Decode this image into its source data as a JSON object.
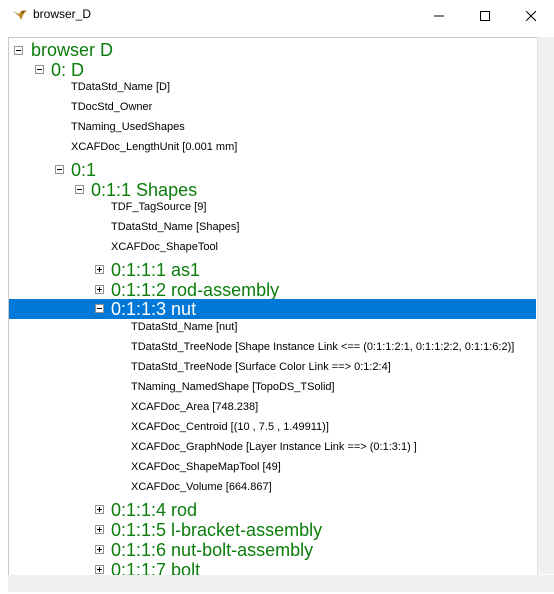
{
  "window": {
    "title": "browser_D"
  },
  "icons": {
    "app": "duck-icon",
    "minimize": "minimize-icon",
    "maximize": "maximize-icon",
    "close": "close-icon"
  },
  "colors": {
    "node_label": "#0a7d0a",
    "selection": "#0078d7",
    "attribute_text": "#000000"
  },
  "tree": {
    "root": "browser  D",
    "d_node": "0: D",
    "d_attrs": [
      "TDataStd_Name [D]",
      "TDocStd_Owner",
      "TNaming_UsedShapes",
      "XCAFDoc_LengthUnit [0.001 mm]"
    ],
    "n01": "0:1",
    "shapes": "0:1:1 Shapes",
    "shapes_attrs": [
      "TDF_TagSource [9]",
      "TDataStd_Name [Shapes]",
      "XCAFDoc_ShapeTool"
    ],
    "as1": "0:1:1:1 as1",
    "rod_assembly": "0:1:1:2 rod-assembly",
    "nut": "0:1:1:3 nut",
    "nut_attrs": [
      "TDataStd_Name [nut]",
      "TDataStd_TreeNode [Shape Instance Link <== (0:1:1:2:1, 0:1:1:2:2, 0:1:1:6:2)]",
      "TDataStd_TreeNode [Surface Color Link ==> 0:1:2:4]",
      "TNaming_NamedShape [TopoDS_TSolid]",
      "XCAFDoc_Area [748.238]",
      "XCAFDoc_Centroid [(10 , 7.5 , 1.49911)]",
      "XCAFDoc_GraphNode [Layer Instance Link ==> (0:1:3:1) ]",
      "XCAFDoc_ShapeMapTool [49]",
      "XCAFDoc_Volume [664.867]"
    ],
    "rod": "0:1:1:4 rod",
    "l_bracket": "0:1:1:5 l-bracket-assembly",
    "nut_bolt": "0:1:1:6 nut-bolt-assembly",
    "bolt": "0:1:1:7 bolt"
  }
}
